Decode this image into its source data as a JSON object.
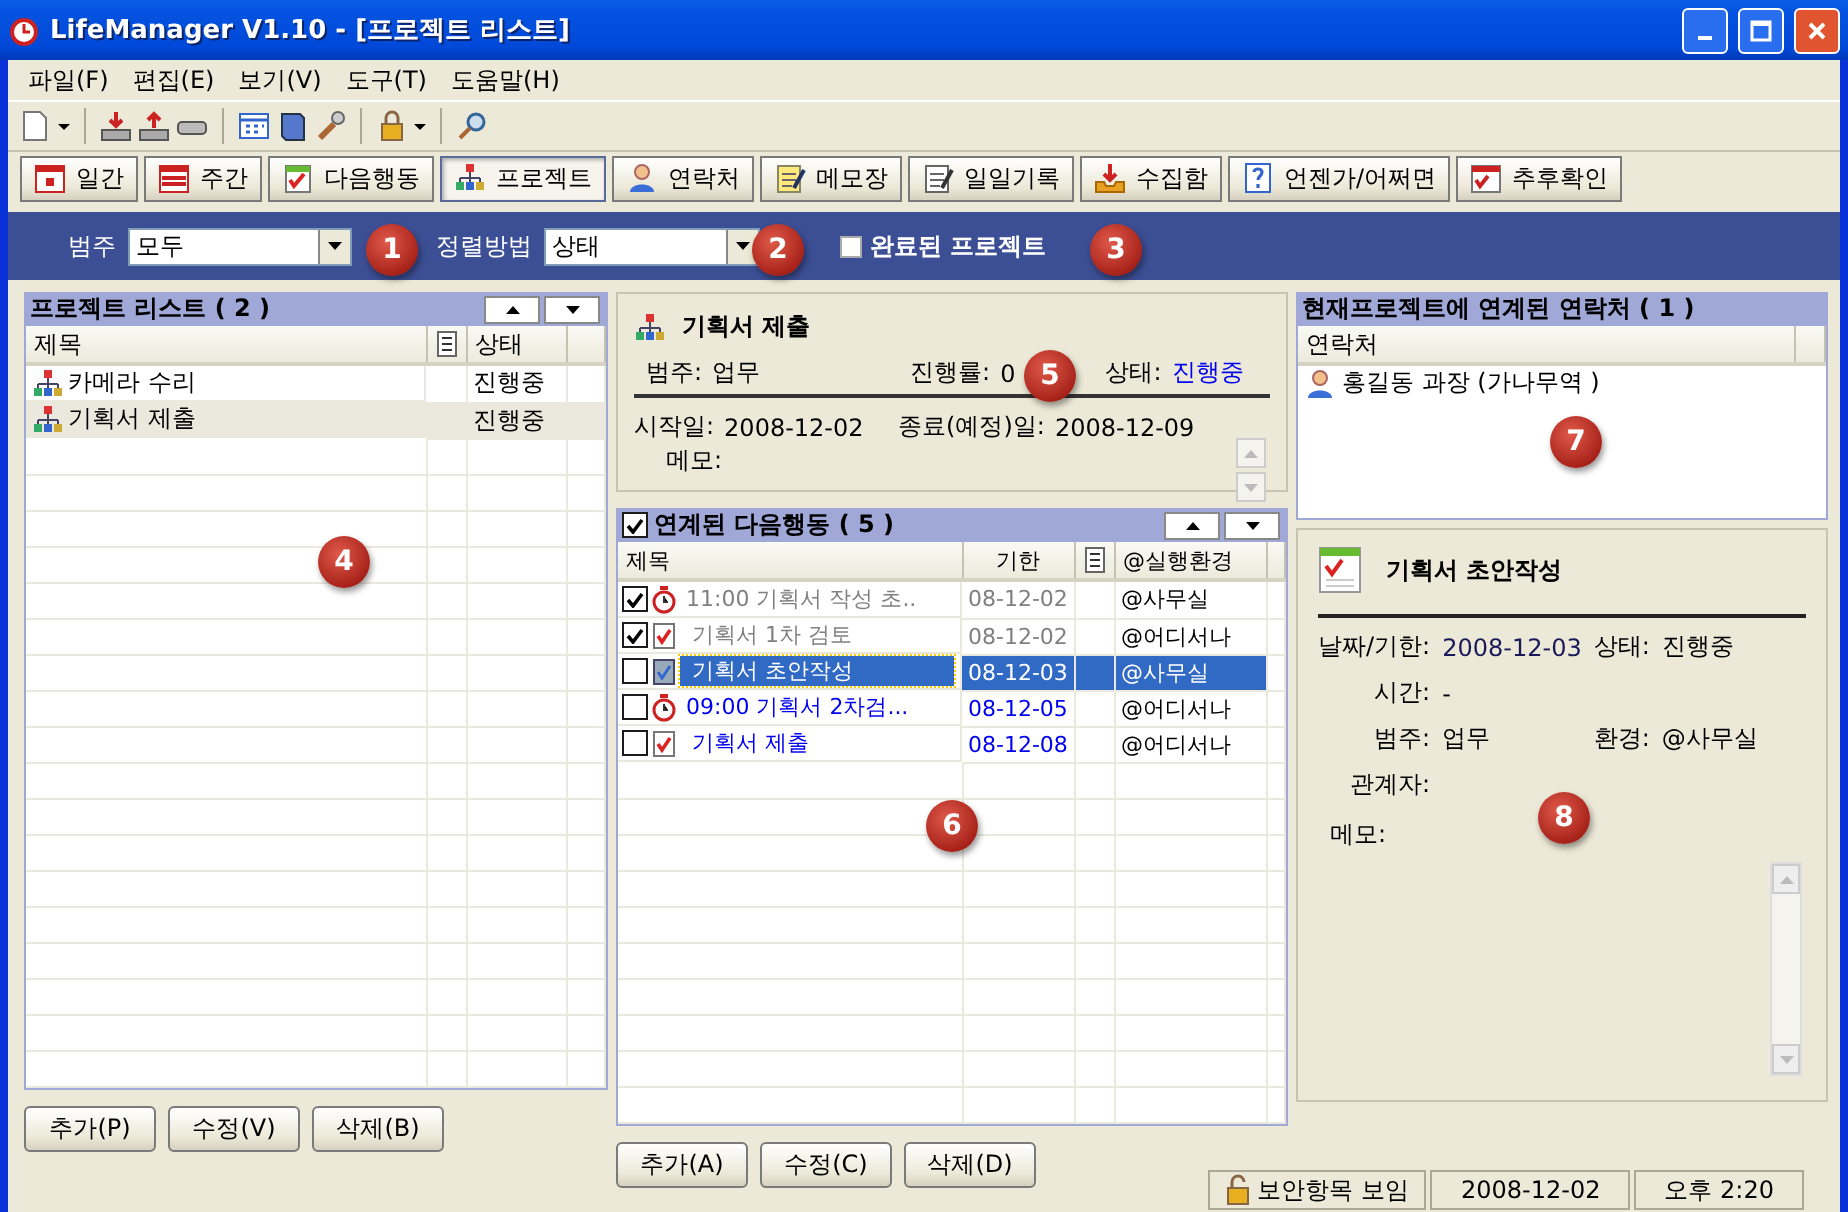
{
  "window": {
    "title": "LifeManager V1.10 - [프로젝트 리스트]"
  },
  "menu": [
    "파일(F)",
    "편집(E)",
    "보기(V)",
    "도구(T)",
    "도움말(H)"
  ],
  "nav_buttons": [
    {
      "label": "일간",
      "kind": "day",
      "selected": false
    },
    {
      "label": "주간",
      "kind": "week",
      "selected": false
    },
    {
      "label": "다음행동",
      "kind": "next",
      "selected": false
    },
    {
      "label": "프로젝트",
      "kind": "project",
      "selected": true
    },
    {
      "label": "연락처",
      "kind": "contact",
      "selected": false
    },
    {
      "label": "메모장",
      "kind": "memo",
      "selected": false
    },
    {
      "label": "일일기록",
      "kind": "log",
      "selected": false
    },
    {
      "label": "수집함",
      "kind": "inbox",
      "selected": false
    },
    {
      "label": "언젠가/어쩌면",
      "kind": "someday",
      "selected": false
    },
    {
      "label": "추후확인",
      "kind": "followup",
      "selected": false
    }
  ],
  "filter_bar": {
    "category_label": "범주",
    "category_value": "모두",
    "sort_label": "정렬방법",
    "sort_value": "상태",
    "completed": {
      "label": "완료된 프로젝트",
      "checked": false
    }
  },
  "project_list": {
    "title": "프로젝트 리스트 ( 2 )",
    "columns": [
      "제목",
      "상태"
    ],
    "rows": [
      {
        "title": "카메라 수리",
        "status": "진행중",
        "selected": false
      },
      {
        "title": "기획서 제출",
        "status": "진행중",
        "selected": true
      }
    ],
    "buttons": [
      "추가(P)",
      "수정(V)",
      "삭제(B)"
    ]
  },
  "project_detail": {
    "title": "기획서 제출",
    "category_label": "범주:",
    "category": "업무",
    "progress_label": "진행률:",
    "progress": "0",
    "status_label": "상태:",
    "status": "진행중",
    "start_label": "시작일:",
    "start": "2008-12-02",
    "end_label": "종료(예정)일:",
    "end": "2008-12-09",
    "memo_label": "메모:"
  },
  "next_actions": {
    "title": "연계된 다음행동 ( 5 )",
    "checked": true,
    "columns": [
      "제목",
      "기한",
      "@실행환경"
    ],
    "rows": [
      {
        "done": true,
        "kind": "timed",
        "title": "11:00 기획서 작성 초..",
        "due": "08-12-02",
        "context": "@사무실",
        "selected": false
      },
      {
        "done": true,
        "kind": "task",
        "title": "기획서 1차 검토",
        "due": "08-12-02",
        "context": "@어디서나",
        "selected": false
      },
      {
        "done": false,
        "kind": "task",
        "title": "기획서 초안작성",
        "due": "08-12-03",
        "context": "@사무실",
        "selected": true
      },
      {
        "done": false,
        "kind": "timed",
        "title": "09:00 기획서 2차검...",
        "due": "08-12-05",
        "context": "@어디서나",
        "selected": false
      },
      {
        "done": false,
        "kind": "task",
        "title": "기획서 제출",
        "due": "08-12-08",
        "context": "@어디서나",
        "selected": false
      }
    ],
    "buttons": [
      "추가(A)",
      "수정(C)",
      "삭제(D)"
    ]
  },
  "contacts": {
    "title": "현재프로젝트에 연계된 연락처 ( 1 )",
    "columns": [
      "연락처"
    ],
    "rows": [
      "홍길동 과장 (가나무역 )"
    ]
  },
  "action_detail": {
    "title": "기획서 초안작성",
    "date_label": "날짜/기한:",
    "date": "2008-12-03",
    "status_label": "상태:",
    "status": "진행중",
    "time_label": "시간:",
    "time": "-",
    "category_label": "범주:",
    "category": "업무",
    "context_label": "환경:",
    "context": "@사무실",
    "people_label": "관계자:",
    "memo_label": "메모:"
  },
  "status_bar": {
    "security": "보안항목 보임",
    "date": "2008-12-02",
    "time": "오후 2:20"
  },
  "callouts": [
    "1",
    "2",
    "3",
    "4",
    "5",
    "6",
    "7",
    "8"
  ]
}
